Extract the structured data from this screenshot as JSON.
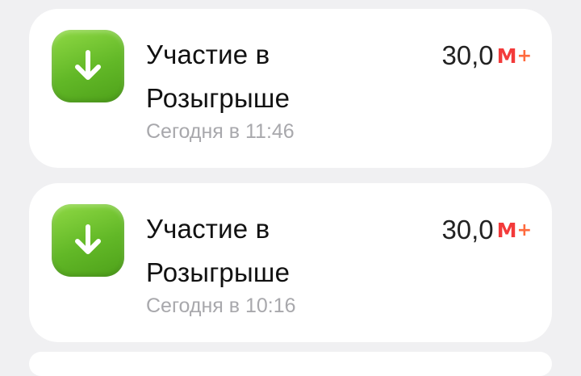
{
  "transactions": [
    {
      "title": "Участие в Розыгрыше",
      "date": "Сегодня в 11:46",
      "amount": "30,0",
      "currency_m": "М",
      "currency_plus": "+",
      "icon": "arrow-down-icon"
    },
    {
      "title": "Участие в Розыгрыше",
      "date": "Сегодня в 10:16",
      "amount": "30,0",
      "currency_m": "М",
      "currency_plus": "+",
      "icon": "arrow-down-icon"
    }
  ],
  "colors": {
    "background": "#f0f0f2",
    "card": "#ffffff",
    "icon_green": "#62b827",
    "brand_red": "#f33a3a",
    "date_gray": "#a8a8ac"
  }
}
